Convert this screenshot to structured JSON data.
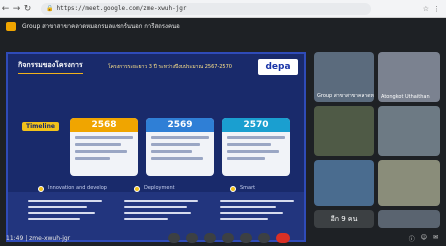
{
  "browser": {
    "url": "https://meet.google.com/zme-xwuh-jgr",
    "icons": [
      "back-icon",
      "forward-icon",
      "reload-icon",
      "lock-icon"
    ]
  },
  "meet": {
    "title": "Group สาขาสาขาคลาดหมอกรมลแชกร์นนอก การีสถรงคนอ",
    "time_code": "11:49 | zme-xwuh-jgr",
    "colors": {
      "accent": "#f2c21b",
      "background": "#1e2125",
      "end_call": "#d93025"
    }
  },
  "slide": {
    "heading": "กิจกรรมของโครงการ",
    "subtitle": "โครงการระยะยาว 3 ปี ระหว่างปีงบประมาณ 2567-2570",
    "logo": "depa",
    "timeline_label": "Timeline",
    "years": [
      "2568",
      "2569",
      "2570"
    ],
    "stages": [
      "Innovation and develop",
      "Deployment",
      "Smart"
    ]
  },
  "participants": [
    {
      "name": "Group สาขาสาขาคลาดหมอกรมลแชกร์นนอก"
    },
    {
      "name": "Atongkot Uthaithan"
    },
    {
      "name": ""
    },
    {
      "name": ""
    },
    {
      "name": ""
    },
    {
      "name": ""
    },
    {
      "name": "อีก 9 คน"
    },
    {
      "name": ""
    }
  ]
}
